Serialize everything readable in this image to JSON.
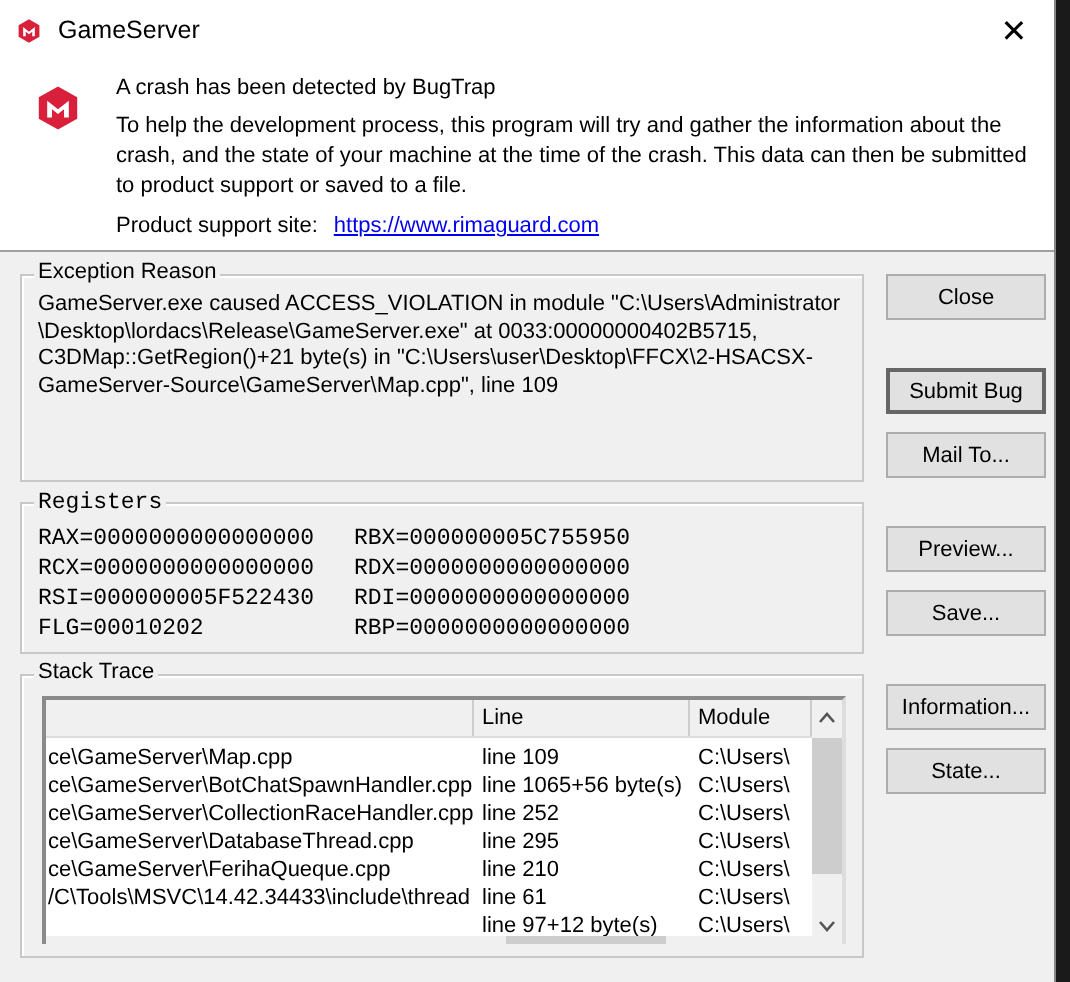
{
  "window": {
    "title": "GameServer",
    "close": "✕"
  },
  "header": {
    "heading": "A crash has been detected by BugTrap",
    "message": "To help the development process, this program will try and gather the information about the crash, and the state of your machine at the time of the crash. This data can then be submitted to product support or saved to a file.",
    "support_label": "Product support site:",
    "support_link": "https://www.rimaguard.com"
  },
  "exception": {
    "label": "Exception Reason",
    "text": "GameServer.exe caused ACCESS_VIOLATION in module \"C:\\Users\\Administrator \\Desktop\\lordacs\\Release\\GameServer.exe\" at 0033:00000000402B5715, C3DMap::GetRegion()+21 byte(s) in \"C:\\Users\\user\\Desktop\\FFCX\\2-HSACSX-GameServer-Source\\GameServer\\Map.cpp\", line 109"
  },
  "registers": {
    "label": "Registers",
    "items": [
      "RAX=0000000000000000",
      "RBX=000000005C755950",
      "RCX=0000000000000000",
      "RDX=0000000000000000",
      "RSI=000000005F522430",
      "RDI=0000000000000000",
      "FLG=00010202",
      "RBP=0000000000000000"
    ]
  },
  "stack_trace": {
    "label": "Stack Trace",
    "columns": [
      "Line",
      "Module"
    ],
    "rows": [
      {
        "file": "ce\\GameServer\\Map.cpp",
        "line": "line 109",
        "module": "C:\\Users\\"
      },
      {
        "file": "ce\\GameServer\\BotChatSpawnHandler.cpp",
        "line": "line 1065+56 byte(s)",
        "module": "C:\\Users\\"
      },
      {
        "file": "ce\\GameServer\\CollectionRaceHandler.cpp",
        "line": "line 252",
        "module": "C:\\Users\\"
      },
      {
        "file": "ce\\GameServer\\DatabaseThread.cpp",
        "line": "line 295",
        "module": "C:\\Users\\"
      },
      {
        "file": "ce\\GameServer\\FerihaQueque.cpp",
        "line": "line 210",
        "module": "C:\\Users\\"
      },
      {
        "file": "/C\\Tools\\MSVC\\14.42.34433\\include\\thread",
        "line": "line 61",
        "module": "C:\\Users\\"
      },
      {
        "line": "line 97+12 byte(s)",
        "module": "C:\\Users\\"
      }
    ]
  },
  "button_groups": [
    [
      {
        "label": "Close",
        "default": false
      }
    ],
    [
      {
        "label": "Submit Bug",
        "default": true
      },
      {
        "label": "Mail To...",
        "default": false
      }
    ],
    [
      {
        "label": "Preview...",
        "default": false
      },
      {
        "label": "Save...",
        "default": false
      }
    ],
    [
      {
        "label": "Information...",
        "default": false
      },
      {
        "label": "State...",
        "default": false
      }
    ]
  ]
}
